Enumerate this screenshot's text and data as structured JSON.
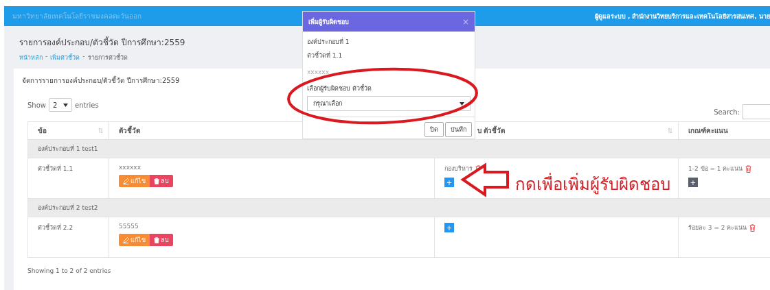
{
  "header": {
    "title": "มหาวิทยาลัยเทคโนโลยีราชมงคลตะวันออก",
    "user": "ผู้ดูแลระบบ , สำนักงานวิทยบริการและเทคโนโลยีสารสนเทศ, นาย"
  },
  "page": {
    "title": "รายการองค์ประกอบ/ตัวชี้วัด ปีการศึกษา:2559",
    "breadcrumb": [
      {
        "label": "หน้าหลัก",
        "link": true
      },
      {
        "label": "-",
        "link": false
      },
      {
        "label": "เพิ่มตัวชี้วัด",
        "link": true
      },
      {
        "label": "-",
        "link": false
      },
      {
        "label": "รายการตัวชี้วัด",
        "link": false
      }
    ]
  },
  "card": {
    "title": "จัดการรายการองค์ประกอบ/ตัวชี้วัด ปีการศึกษา:2559",
    "show_label": "Show",
    "page_size": "2",
    "entries_label": "entries",
    "search_label": "Search:",
    "info": "Showing 1 to 2 of 2 entries"
  },
  "table": {
    "columns": [
      {
        "label": "ข้อ",
        "sortable": true
      },
      {
        "label": "ตัวชี้วัด"
      },
      {
        "label": "บ ตัวชี้วัด",
        "sortable": true
      },
      {
        "label": "เกณฑ์คะแนน"
      }
    ],
    "groups": [
      {
        "title": "องค์ประกอบที่ 1 test1",
        "rows": [
          {
            "indicator": "ตัวชี้วัดที่ 1.1",
            "detail": "xxxxxx",
            "edit": "แก้ไข",
            "delete": "ลบ",
            "responsible": [
              "กองบริหาร"
            ],
            "add": "+",
            "criteria": [
              "1-2 ข้อ = 1 คะแนน"
            ],
            "criteria_add": "+"
          }
        ]
      },
      {
        "title": "องค์ประกอบที่ 2 test2",
        "rows": [
          {
            "indicator": "ตัวชี้วัดที่ 2.2",
            "detail": "55555",
            "edit": "แก้ไข",
            "delete": "ลบ",
            "responsible": [],
            "add": "+",
            "criteria": [
              "ร้อยละ 3 = 2 คะแนน"
            ]
          }
        ]
      }
    ]
  },
  "modal": {
    "title": "เพิ่มผู้รับผิดชอบ",
    "close": "×",
    "lines": [
      "องค์ประกอบที่ 1",
      "ตัวชี้วัดที่ 1.1",
      "xxxxxx"
    ],
    "select_label": "เลือกผู้รับผิดชอบ ตัวชี้วัด",
    "select_placeholder": "กรุณาเลือก",
    "buttons": [
      "ปิด",
      "บันทึก"
    ]
  },
  "annotation": {
    "text": "กดเพื่อเพิ่มผู้รับผิดชอบ"
  }
}
